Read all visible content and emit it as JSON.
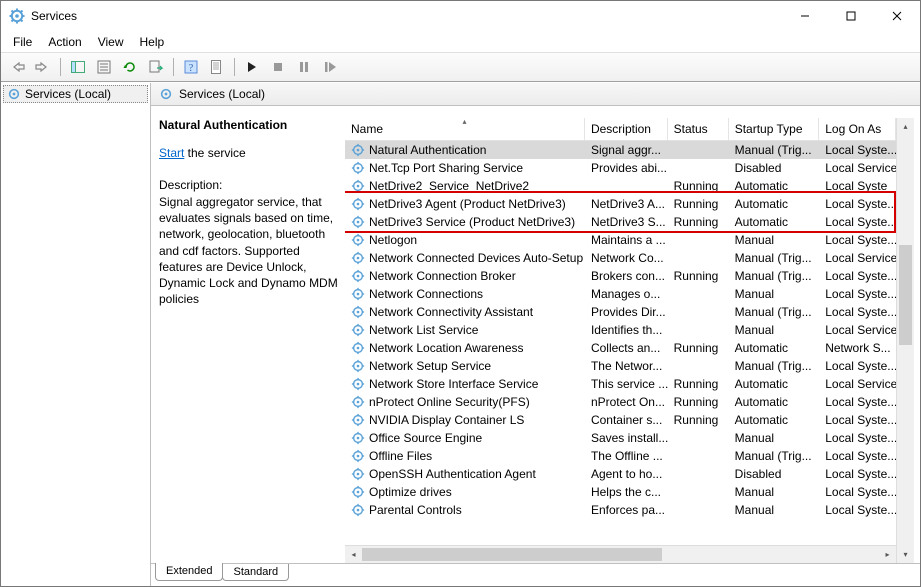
{
  "window": {
    "title": "Services"
  },
  "menu": {
    "file": "File",
    "action": "Action",
    "view": "View",
    "help": "Help"
  },
  "tree": {
    "root_label": "Services (Local)"
  },
  "panel": {
    "header": "Services (Local)",
    "selected_name": "Natural Authentication",
    "start_link": "Start",
    "start_suffix": " the service",
    "desc_label": "Description:",
    "description": "Signal aggregator service, that evaluates signals based on time, network, geolocation, bluetooth and cdf factors. Supported features are Device Unlock, Dynamic Lock and Dynamo MDM policies"
  },
  "columns": {
    "name": "Name",
    "description": "Description",
    "status": "Status",
    "startup": "Startup Type",
    "logon": "Log On As"
  },
  "rows": [
    {
      "name": "Natural Authentication",
      "desc": "Signal aggr...",
      "status": "",
      "startup": "Manual (Trig...",
      "logon": "Local Syste...",
      "selected": true
    },
    {
      "name": "Net.Tcp Port Sharing Service",
      "desc": "Provides abi...",
      "status": "",
      "startup": "Disabled",
      "logon": "Local Service"
    },
    {
      "name": "NetDrive2_Service_NetDrive2",
      "desc": "",
      "status": "Running",
      "startup": "Automatic",
      "logon": "Local Syste"
    },
    {
      "name": "NetDrive3 Agent (Product NetDrive3)",
      "desc": "NetDrive3 A...",
      "status": "Running",
      "startup": "Automatic",
      "logon": "Local Syste..."
    },
    {
      "name": "NetDrive3 Service (Product NetDrive3)",
      "desc": "NetDrive3 S...",
      "status": "Running",
      "startup": "Automatic",
      "logon": "Local Syste..."
    },
    {
      "name": "Netlogon",
      "desc": "Maintains a ...",
      "status": "",
      "startup": "Manual",
      "logon": "Local Syste..."
    },
    {
      "name": "Network Connected Devices Auto-Setup",
      "desc": "Network Co...",
      "status": "",
      "startup": "Manual (Trig...",
      "logon": "Local Service"
    },
    {
      "name": "Network Connection Broker",
      "desc": "Brokers con...",
      "status": "Running",
      "startup": "Manual (Trig...",
      "logon": "Local Syste..."
    },
    {
      "name": "Network Connections",
      "desc": "Manages o...",
      "status": "",
      "startup": "Manual",
      "logon": "Local Syste..."
    },
    {
      "name": "Network Connectivity Assistant",
      "desc": "Provides Dir...",
      "status": "",
      "startup": "Manual (Trig...",
      "logon": "Local Syste..."
    },
    {
      "name": "Network List Service",
      "desc": "Identifies th...",
      "status": "",
      "startup": "Manual",
      "logon": "Local Service"
    },
    {
      "name": "Network Location Awareness",
      "desc": "Collects an...",
      "status": "Running",
      "startup": "Automatic",
      "logon": "Network S..."
    },
    {
      "name": "Network Setup Service",
      "desc": "The Networ...",
      "status": "",
      "startup": "Manual (Trig...",
      "logon": "Local Syste..."
    },
    {
      "name": "Network Store Interface Service",
      "desc": "This service ...",
      "status": "Running",
      "startup": "Automatic",
      "logon": "Local Service"
    },
    {
      "name": "nProtect Online Security(PFS)",
      "desc": "nProtect On...",
      "status": "Running",
      "startup": "Automatic",
      "logon": "Local Syste..."
    },
    {
      "name": "NVIDIA Display Container LS",
      "desc": "Container s...",
      "status": "Running",
      "startup": "Automatic",
      "logon": "Local Syste..."
    },
    {
      "name": "Office  Source Engine",
      "desc": "Saves install...",
      "status": "",
      "startup": "Manual",
      "logon": "Local Syste..."
    },
    {
      "name": "Offline Files",
      "desc": "The Offline ...",
      "status": "",
      "startup": "Manual (Trig...",
      "logon": "Local Syste..."
    },
    {
      "name": "OpenSSH Authentication Agent",
      "desc": "Agent to ho...",
      "status": "",
      "startup": "Disabled",
      "logon": "Local Syste..."
    },
    {
      "name": "Optimize drives",
      "desc": "Helps the c...",
      "status": "",
      "startup": "Manual",
      "logon": "Local Syste..."
    },
    {
      "name": "Parental Controls",
      "desc": "Enforces pa...",
      "status": "",
      "startup": "Manual",
      "logon": "Local Syste..."
    }
  ],
  "tabs": {
    "extended": "Extended",
    "standard": "Standard"
  },
  "highlight": {
    "topRow": 3,
    "rowCount": 2
  }
}
